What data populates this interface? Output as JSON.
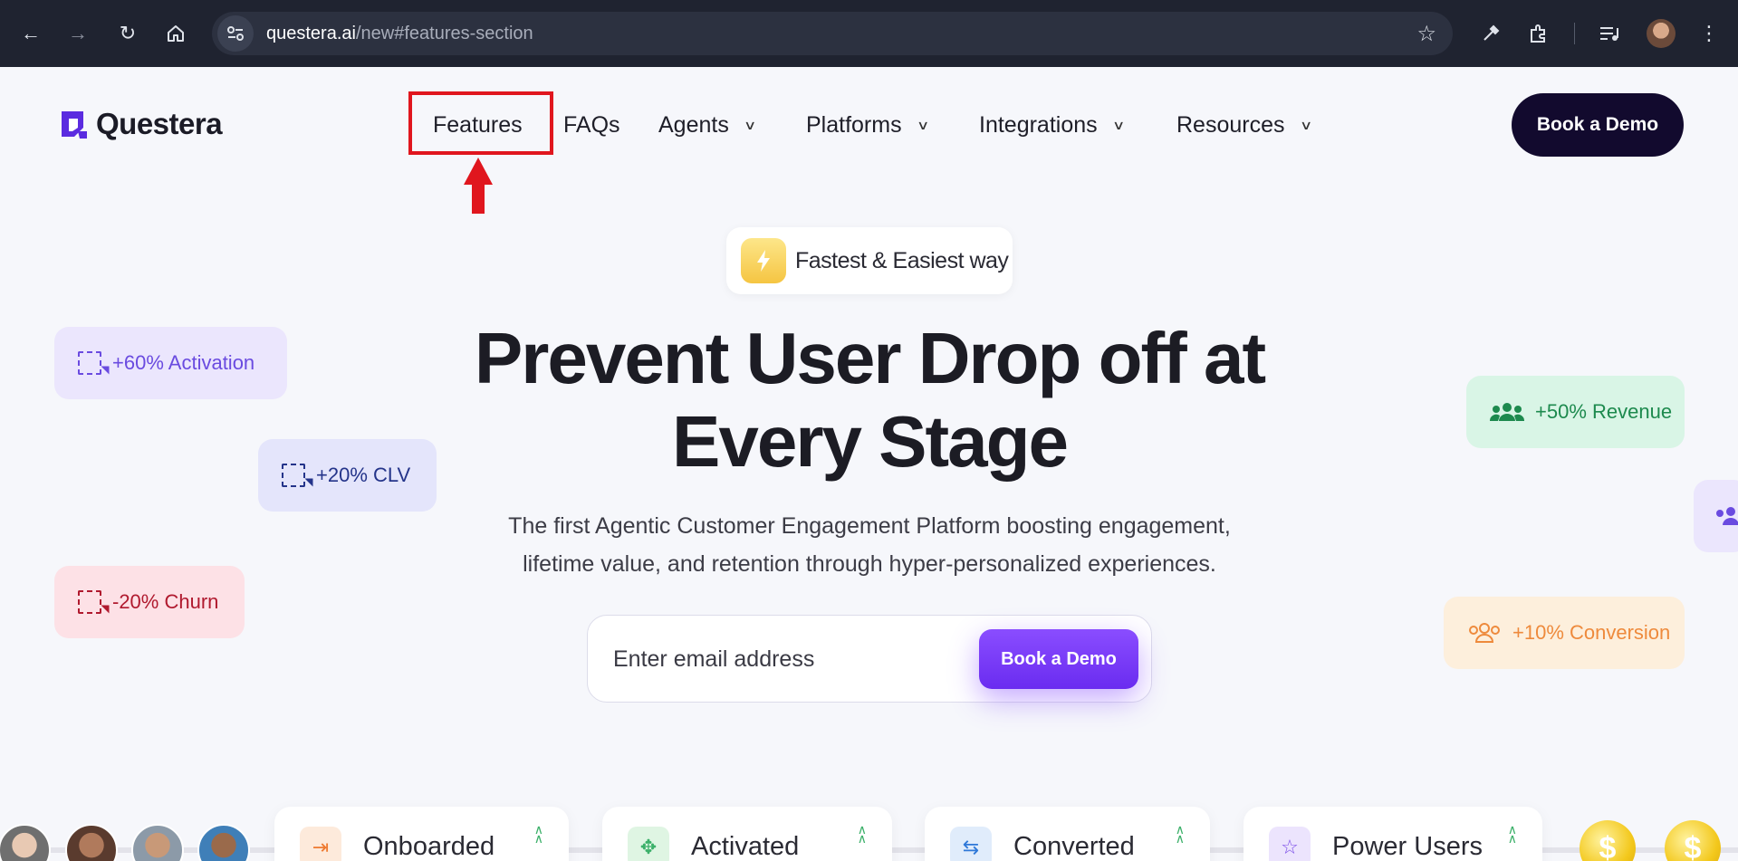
{
  "browser": {
    "url_host": "questera.ai",
    "url_path": "/new#features-section"
  },
  "header": {
    "logo_text": "Questera",
    "nav": [
      {
        "label": "Features",
        "has_dropdown": false
      },
      {
        "label": "FAQs",
        "has_dropdown": false
      },
      {
        "label": "Agents",
        "has_dropdown": true
      },
      {
        "label": "Platforms",
        "has_dropdown": true
      },
      {
        "label": "Integrations",
        "has_dropdown": true
      },
      {
        "label": "Resources",
        "has_dropdown": true
      }
    ],
    "cta_label": "Book a Demo"
  },
  "hero": {
    "pill_text": "Fastest & Easiest way",
    "headline_line1": "Prevent User Drop off at",
    "headline_line2": "Every Stage",
    "subline_line1": "The first Agentic Customer Engagement Platform boosting engagement,",
    "subline_line2": "lifetime value, and retention through hyper-personalized experiences.",
    "email_placeholder": "Enter email address",
    "cta_label": "Book a Demo"
  },
  "stats": {
    "activation": "+60% Activation",
    "clv": "+20% CLV",
    "churn": "-20% Churn",
    "revenue": "+50% Revenue",
    "conversion": "+10% Conversion"
  },
  "funnel": {
    "stages": [
      "Onboarded",
      "Activated",
      "Converted",
      "Power Users"
    ],
    "coin_symbol": "$"
  },
  "colors": {
    "annotation_red": "#e0161e",
    "brand_purple": "#6a2cf0",
    "cta_dark": "#120a2e"
  }
}
